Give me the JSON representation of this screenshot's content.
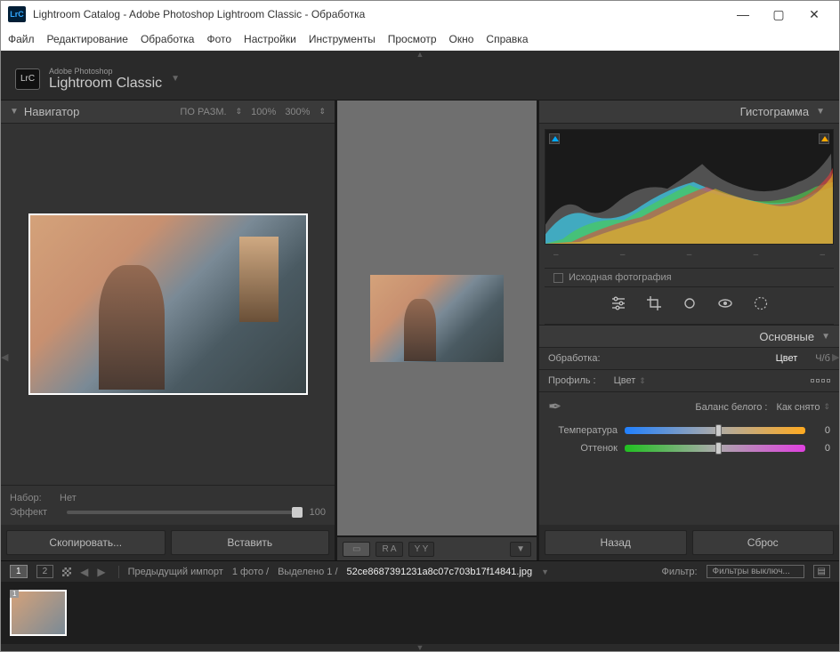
{
  "titlebar": {
    "title": "Lightroom Catalog - Adobe Photoshop Lightroom Classic - Обработка"
  },
  "menu": {
    "file": "Файл",
    "edit": "Редактирование",
    "develop": "Обработка",
    "photo": "Фото",
    "settings": "Настройки",
    "tools": "Инструменты",
    "view": "Просмотр",
    "window": "Окно",
    "help": "Справка"
  },
  "brand": {
    "small": "Adobe Photoshop",
    "big": "Lightroom Classic",
    "logo": "LrC"
  },
  "navigator": {
    "title": "Навигатор",
    "fit": "ПО РАЗМ.",
    "z1": "100%",
    "z2": "300%",
    "preset_label": "Набор:",
    "preset_value": "Нет",
    "effect_label": "Эффект",
    "effect_value": "100"
  },
  "buttons": {
    "copy": "Скопировать...",
    "paste": "Вставить",
    "back": "Назад",
    "reset": "Сброс"
  },
  "histogram": {
    "title": "Гистограмма",
    "axis": [
      "–",
      "–",
      "–",
      "–",
      "–"
    ]
  },
  "original": {
    "label": "Исходная фотография"
  },
  "basic": {
    "title": "Основные",
    "treatment_label": "Обработка:",
    "treatment_value": "Цвет",
    "bw": "Ч/б",
    "profile_label": "Профиль :",
    "profile_value": "Цвет",
    "wb_label": "Баланс белого :",
    "wb_value": "Как снято",
    "temp_label": "Температура",
    "temp_value": "0",
    "tint_label": "Оттенок",
    "tint_value": "0"
  },
  "center_toolbar": {
    "ra": "R A",
    "yy": "Y Y"
  },
  "filmbar": {
    "v1": "1",
    "v2": "2",
    "prev_import": "Предыдущий импорт",
    "count": "1 фото /",
    "sel": "Выделено 1 /",
    "filename": "52ce8687391231a8c07c703b17f14841.jpg",
    "filter_label": "Фильтр:",
    "filter_value": "Фильтры выключ..."
  },
  "thumb": {
    "index": "1"
  }
}
